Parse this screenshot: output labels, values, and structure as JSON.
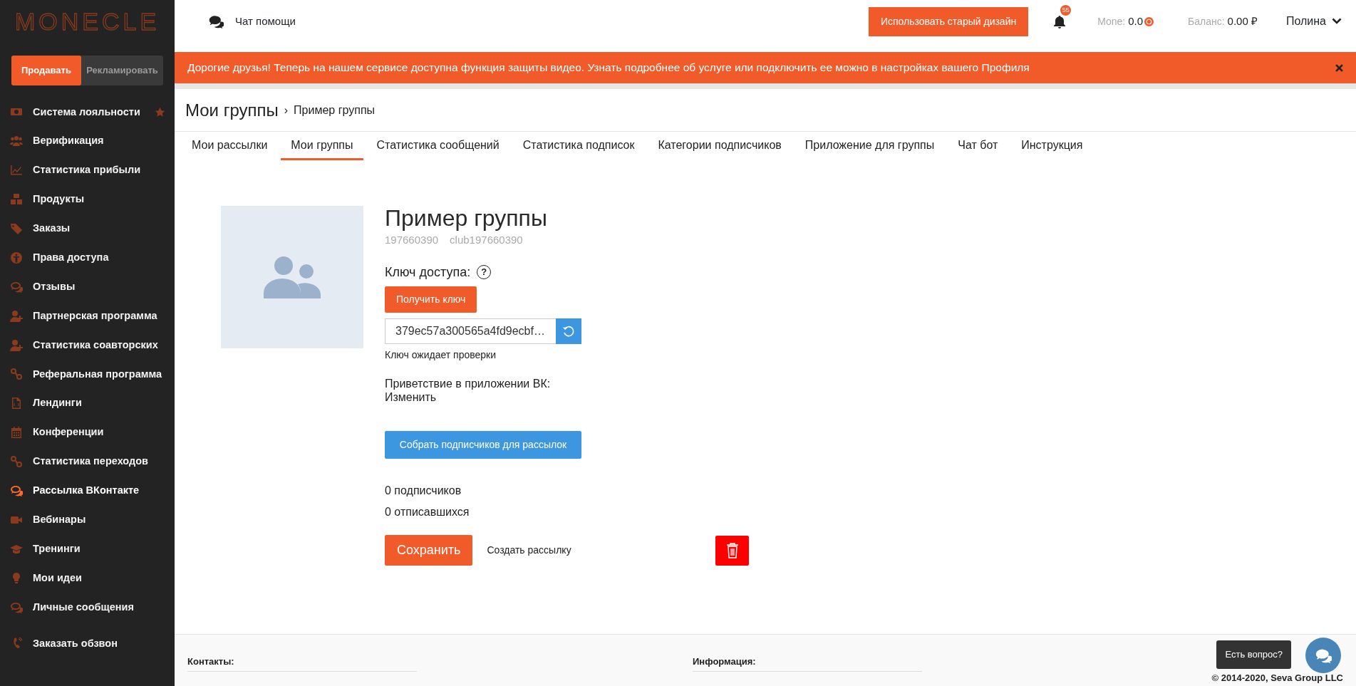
{
  "logo": {
    "text": "MONECLE"
  },
  "mode_switch": [
    {
      "label": "Продавать",
      "selected": true
    },
    {
      "label": "Рекламировать",
      "selected": false
    }
  ],
  "sidebar": {
    "items": [
      {
        "label": "Система лояльности",
        "starred": true,
        "selected": false
      },
      {
        "label": "Верификация",
        "starred": false,
        "selected": false
      },
      {
        "label": "Статистика прибыли",
        "starred": false,
        "selected": false
      },
      {
        "label": "Продукты",
        "starred": false,
        "selected": false
      },
      {
        "label": "Заказы",
        "starred": false,
        "selected": false
      },
      {
        "label": "Права доступа",
        "starred": false,
        "selected": false
      },
      {
        "label": "Отзывы",
        "starred": false,
        "selected": false
      },
      {
        "label": "Партнерская программа",
        "starred": false,
        "selected": false
      },
      {
        "label": "Статистика соавторских",
        "starred": false,
        "selected": false
      },
      {
        "label": "Реферальная программа",
        "starred": false,
        "selected": false
      },
      {
        "label": "Лендинги",
        "starred": false,
        "selected": false
      },
      {
        "label": "Конференции",
        "starred": false,
        "selected": false
      },
      {
        "label": "Статистика переходов",
        "starred": false,
        "selected": false
      },
      {
        "label": "Рассылка ВКонтакте",
        "starred": false,
        "selected": true
      },
      {
        "label": "Вебинары",
        "starred": false,
        "selected": false
      },
      {
        "label": "Тренинги",
        "starred": false,
        "selected": false
      },
      {
        "label": "Мои идеи",
        "starred": false,
        "selected": false
      },
      {
        "label": "Личные сообщения",
        "starred": false,
        "selected": false
      }
    ],
    "bottom_item": {
      "label": "Заказать обзвон"
    }
  },
  "header": {
    "help_chat": "Чат помощи",
    "old_design_button": "Использовать старый дизайн",
    "notification_count": "55",
    "mone_label": "Mone:",
    "mone_value": "0.0",
    "balance_label": "Баланс:",
    "balance_value": "0.00 ₽",
    "user_name": "Полина"
  },
  "banner": {
    "text": "Дорогие друзья! Теперь на нашем сервисе доступна функция защиты видео. Узнать подробнее об услуге или подключить ее можно в настройках вашего Профиля"
  },
  "breadcrumb": {
    "title": "Мои группы",
    "separator": "›",
    "current": "Пример группы"
  },
  "tabs": [
    {
      "label": "Мои рассылки",
      "selected": false
    },
    {
      "label": "Мои группы",
      "selected": true
    },
    {
      "label": "Статистика сообщений",
      "selected": false
    },
    {
      "label": "Статистика подписок",
      "selected": false
    },
    {
      "label": "Категории подписчиков",
      "selected": false
    },
    {
      "label": "Приложение для группы",
      "selected": false
    },
    {
      "label": "Чат бот",
      "selected": false
    },
    {
      "label": "Инструкция",
      "selected": false
    }
  ],
  "group": {
    "name": "Пример группы",
    "id": "197660390",
    "screen_name": "club197660390",
    "key_label": "Ключ доступа:",
    "help_mark": "?",
    "get_key_button": "Получить ключ",
    "key_value": "379ec57a300565a4fd9ecbf…",
    "key_status": "Ключ ожидает проверки",
    "greeting_label": "Приветствие в приложении ВК:",
    "greeting_link": "Изменить",
    "collect_button": "Собрать подписчиков для рассылок",
    "subscribers": "0 подписчиков",
    "unsubscribed": "0 отписавшихся",
    "save_button": "Сохранить",
    "create_mailing_link": "Создать рассылку"
  },
  "footer": {
    "columns": [
      {
        "heading": "Контакты:"
      },
      {
        "heading": "Информация:"
      }
    ],
    "copyright": "© 2014-2020, Seva Group LLC"
  },
  "chat_widget": {
    "tooltip": "Есть вопрос?"
  }
}
